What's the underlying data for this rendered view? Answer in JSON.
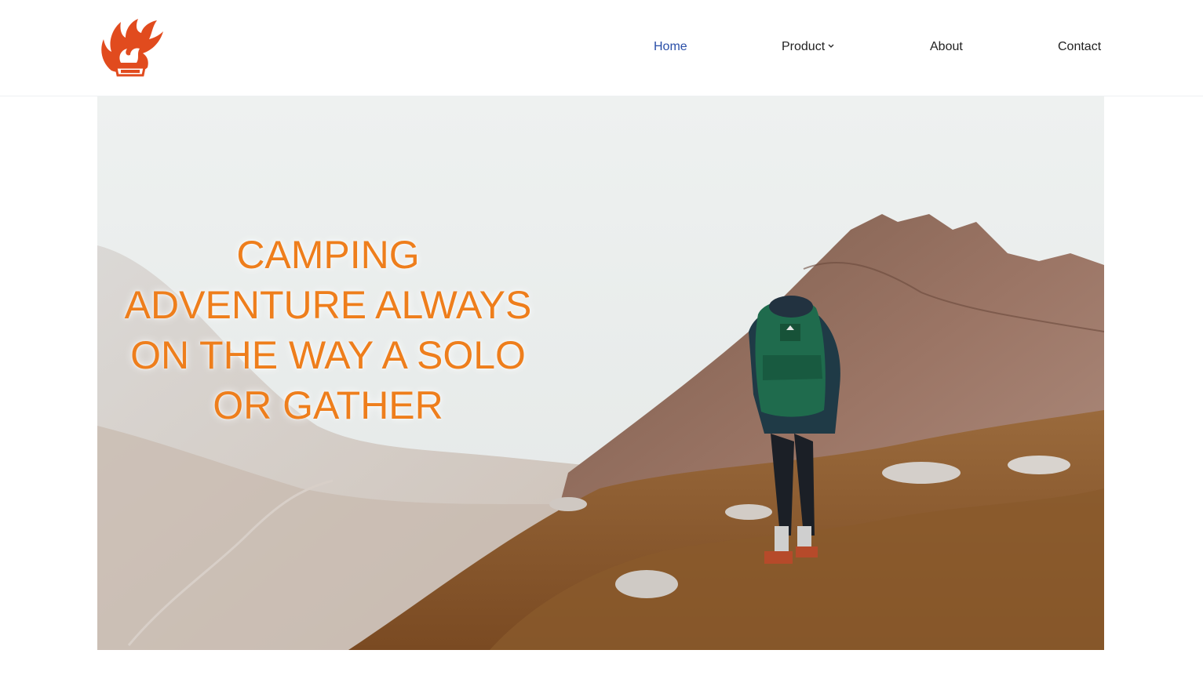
{
  "brand": {
    "logo_icon": "flame-logo-icon",
    "accent": "#e14b1e"
  },
  "nav": {
    "items": [
      {
        "label": "Home",
        "active": true
      },
      {
        "label": "Product",
        "has_dropdown": true
      },
      {
        "label": "About"
      },
      {
        "label": "Contact"
      }
    ],
    "active_color": "#2a4fa8"
  },
  "hero": {
    "title": "CAMPING ADVENTURE ALWAYS ON THE WAY A SOLO OR GATHER",
    "title_color": "#ee7e1c",
    "image": "hiker-on-mountain-ridge"
  }
}
